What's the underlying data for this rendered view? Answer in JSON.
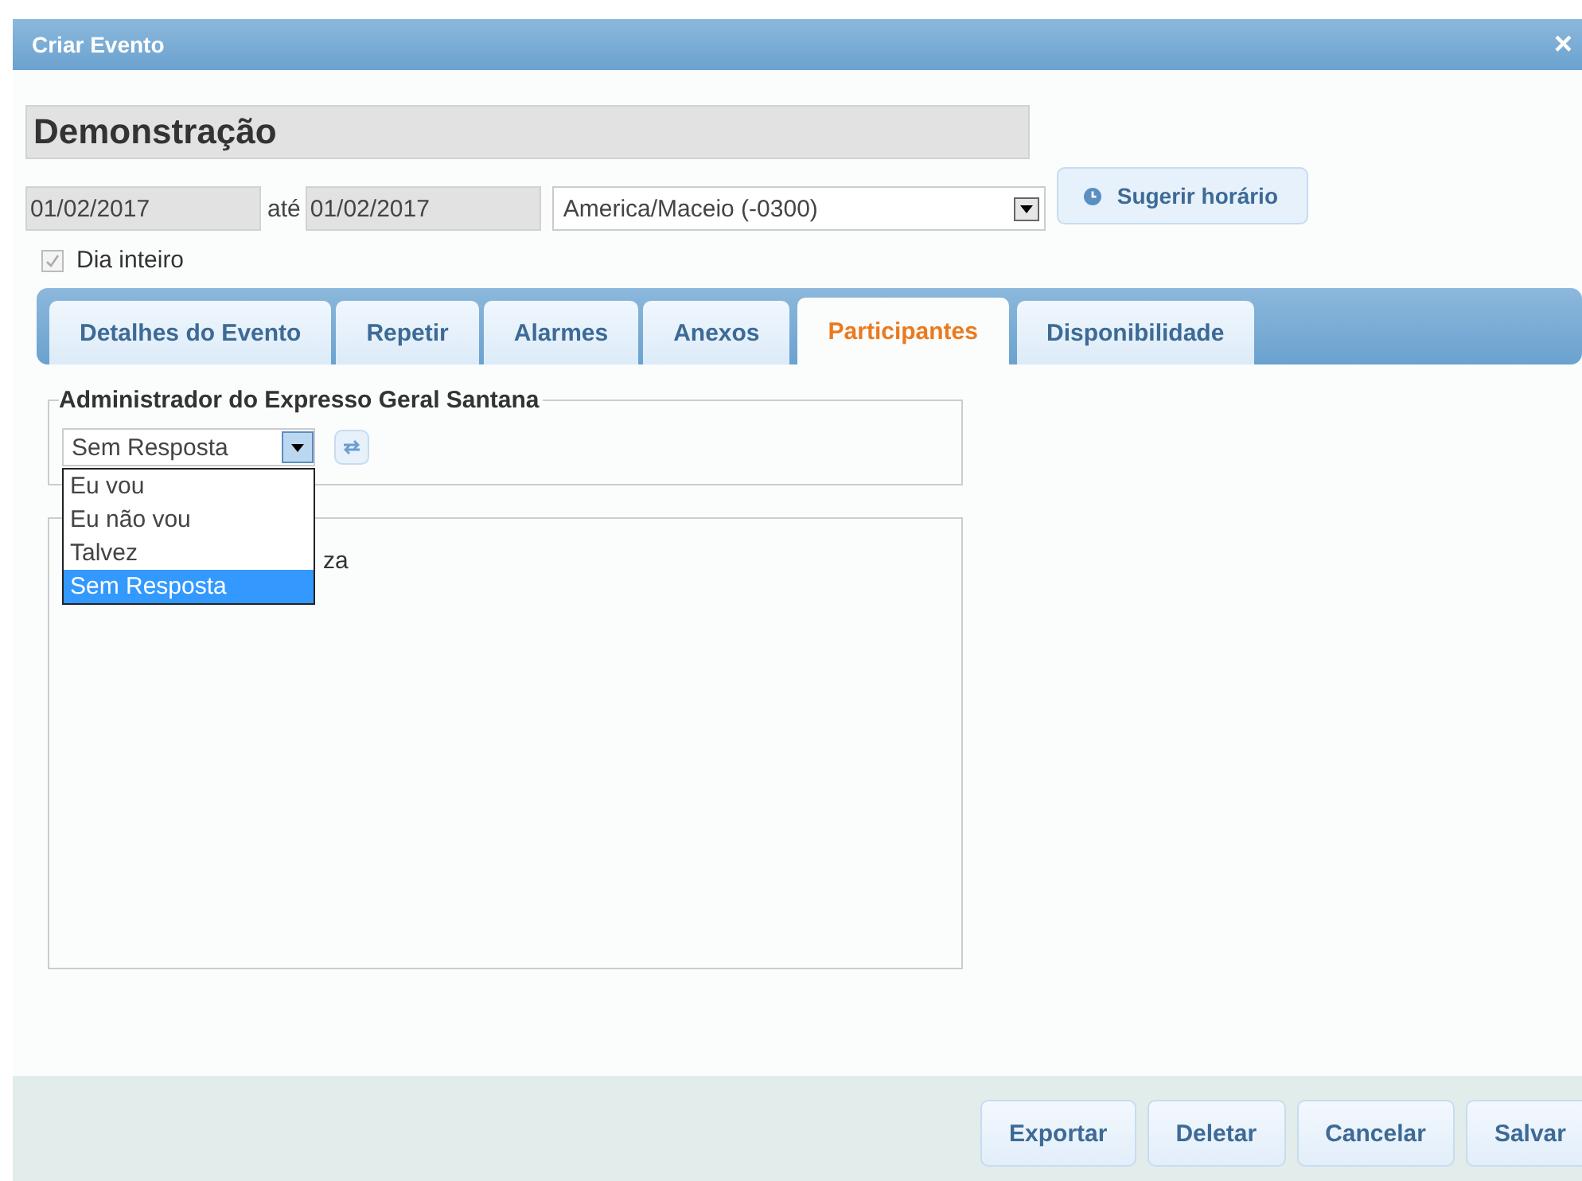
{
  "window": {
    "title": "Criar Evento",
    "close": "×"
  },
  "event_title": "Demonstração",
  "start_date": "01/02/2017",
  "until_label": "até",
  "end_date": "01/02/2017",
  "timezone": "America/Maceio (-0300)",
  "suggest_button": "Sugerir horário",
  "all_day": {
    "label": "Dia inteiro",
    "checked": true,
    "disabled": true
  },
  "tabs": [
    {
      "label": "Detalhes do Evento",
      "selected": false
    },
    {
      "label": "Repetir",
      "selected": false
    },
    {
      "label": "Alarmes",
      "selected": false
    },
    {
      "label": "Anexos",
      "selected": false
    },
    {
      "label": "Participantes",
      "selected": true
    },
    {
      "label": "Disponibilidade",
      "selected": false
    }
  ],
  "organizer": {
    "name": "Administrador do Expresso Geral Santana",
    "response": "Sem Resposta"
  },
  "response_options": [
    {
      "label": "Eu vou",
      "selected": false
    },
    {
      "label": "Eu não vou",
      "selected": false
    },
    {
      "label": "Talvez",
      "selected": false
    },
    {
      "label": "Sem Resposta",
      "selected": true
    }
  ],
  "participants_fragment": "za",
  "buttons": [
    "Exportar",
    "Deletar",
    "Cancelar",
    "Salvar"
  ]
}
